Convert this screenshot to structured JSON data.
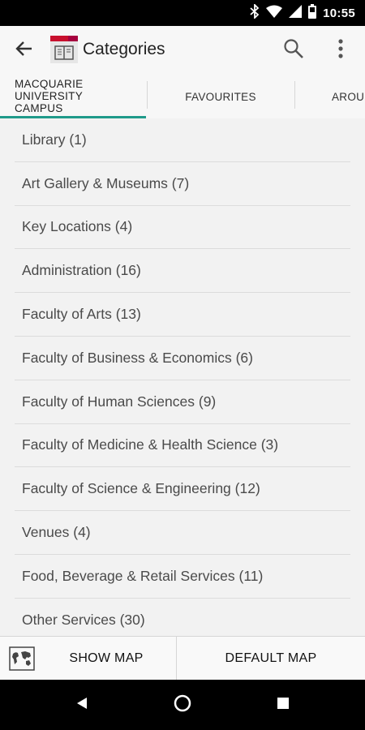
{
  "status_bar": {
    "time": "10:55",
    "icons": [
      "bluetooth-icon",
      "wifi-icon",
      "signal-icon",
      "battery-icon"
    ]
  },
  "app_bar": {
    "title": "Categories",
    "back_icon": "arrow-back-icon",
    "search_icon": "search-icon",
    "more_icon": "more-vert-icon"
  },
  "tabs": [
    {
      "label": "MACQUARIE UNIVERSITY CAMPUS",
      "selected": true
    },
    {
      "label": "FAVOURITES",
      "selected": false
    },
    {
      "label": "AROU",
      "selected": false
    }
  ],
  "categories": [
    "Library (1)",
    "Art Gallery & Museums (7)",
    "Key Locations (4)",
    "Administration (16)",
    "Faculty of Arts (13)",
    "Faculty of Business & Economics (6)",
    "Faculty of Human Sciences (9)",
    "Faculty of Medicine & Health Science (3)",
    "Faculty of Science & Engineering (12)",
    "Venues (4)",
    "Food, Beverage & Retail Services (11)",
    "Other Services (30)"
  ],
  "bottom_bar": {
    "show_map_label": "SHOW MAP",
    "default_map_label": "DEFAULT MAP"
  },
  "colors": {
    "accent": "#1f9a8a",
    "logo_red": "#c8102e",
    "logo_magenta": "#a6003f"
  }
}
